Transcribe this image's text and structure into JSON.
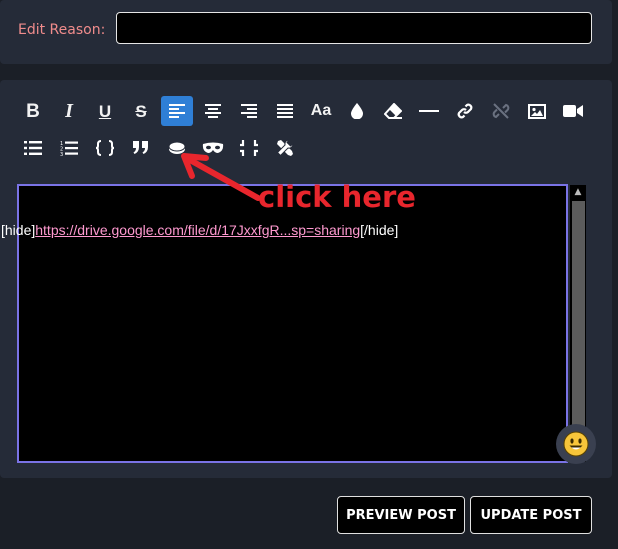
{
  "edit_reason": {
    "label": "Edit Reason:",
    "value": ""
  },
  "toolbar": {
    "row1": [
      {
        "name": "bold-button",
        "icon": "bold-icon",
        "glyph": "B"
      },
      {
        "name": "italic-button",
        "icon": "italic-icon",
        "glyph": "I"
      },
      {
        "name": "underline-button",
        "icon": "underline-icon",
        "glyph": "U"
      },
      {
        "name": "strikethrough-button",
        "icon": "strikethrough-icon",
        "glyph": "S"
      },
      {
        "name": "align-left-button",
        "icon": "align-left-icon",
        "active": true
      },
      {
        "name": "align-center-button",
        "icon": "align-center-icon"
      },
      {
        "name": "align-right-button",
        "icon": "align-right-icon"
      },
      {
        "name": "justify-button",
        "icon": "align-justify-icon"
      },
      {
        "name": "font-size-button",
        "icon": "font-size-icon",
        "glyph": "Aa"
      },
      {
        "name": "text-color-button",
        "icon": "droplet-icon"
      },
      {
        "name": "remove-format-button",
        "icon": "eraser-icon"
      },
      {
        "name": "horizontal-rule-button",
        "icon": "horizontal-rule-icon"
      },
      {
        "name": "insert-link-button",
        "icon": "link-icon"
      },
      {
        "name": "unlink-button",
        "icon": "unlink-icon",
        "disabled": true
      },
      {
        "name": "insert-image-button",
        "icon": "image-icon"
      },
      {
        "name": "insert-video-button",
        "icon": "video-icon"
      }
    ],
    "row2": [
      {
        "name": "bulleted-list-button",
        "icon": "list-bullet-icon"
      },
      {
        "name": "numbered-list-button",
        "icon": "list-numbered-icon"
      },
      {
        "name": "code-button",
        "icon": "code-braces-icon"
      },
      {
        "name": "quote-button",
        "icon": "quote-icon"
      },
      {
        "name": "hide-button",
        "icon": "hide-disc-icon"
      },
      {
        "name": "spoiler-button",
        "icon": "mask-icon"
      },
      {
        "name": "collapse-button",
        "icon": "compress-icon"
      },
      {
        "name": "tools-button",
        "icon": "tools-icon"
      }
    ]
  },
  "editor": {
    "prefix": "[hide]",
    "link_text": "https://drive.google.com/file/d/17JxxfgR...sp=sharing",
    "suffix": "[/hide]"
  },
  "annotation": {
    "text": "click here",
    "color": "#e8262d"
  },
  "buttons": {
    "preview": "PREVIEW POST",
    "update": "UPDATE POST"
  },
  "colors": {
    "panel_bg": "#252b38",
    "page_bg": "#1b1f27",
    "active_button": "#2f7fd6",
    "editor_border": "#7a73e6",
    "label_color": "#f08c8c",
    "link_color": "#ff9ad0"
  }
}
